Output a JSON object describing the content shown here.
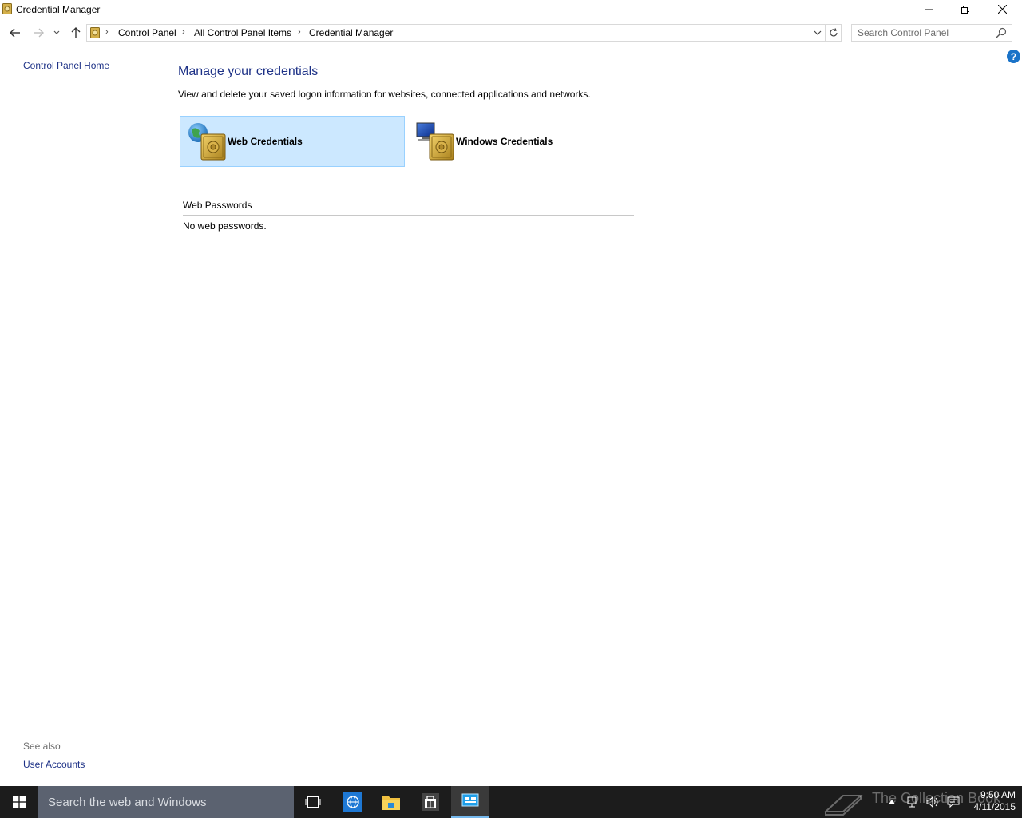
{
  "window": {
    "title": "Credential Manager",
    "minimize_icon": "minimize-icon",
    "maximize_icon": "restore-icon",
    "close_icon": "close-icon"
  },
  "nav": {
    "breadcrumbs": [
      "Control Panel",
      "All Control Panel Items",
      "Credential Manager"
    ],
    "search_placeholder": "Search Control Panel"
  },
  "help_label": "?",
  "left_pane": {
    "home_link": "Control Panel Home",
    "see_also_label": "See also",
    "see_also_links": [
      "User Accounts"
    ]
  },
  "main": {
    "heading": "Manage your credentials",
    "description": "View and delete your saved logon information for websites, connected applications and networks.",
    "tiles": [
      {
        "label": "Web Credentials",
        "selected": true
      },
      {
        "label": "Windows Credentials",
        "selected": false
      }
    ],
    "section_title": "Web Passwords",
    "empty_text": "No web passwords."
  },
  "taskbar": {
    "search_text": "Search the web and Windows",
    "watermark": "The Collection Book",
    "time": "9:50 AM",
    "date": "4/11/2015"
  },
  "colors": {
    "link": "#1e3287",
    "tile_selected_bg": "#cce8ff",
    "tile_selected_border": "#99d1ff",
    "taskbar_bg": "#1c1c1c",
    "taskbar_search_bg": "#5b6270"
  }
}
